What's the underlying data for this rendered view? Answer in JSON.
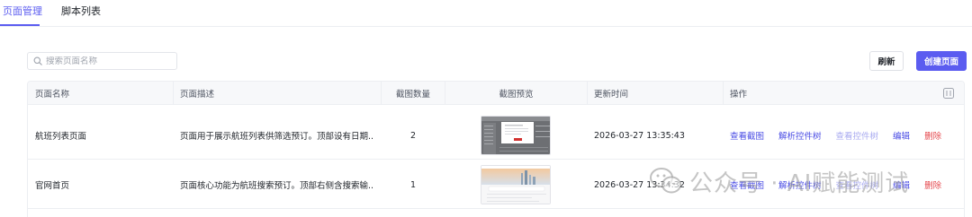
{
  "tabs": [
    {
      "label": "页面管理",
      "active": true
    },
    {
      "label": "脚本列表",
      "active": false
    }
  ],
  "toolbar": {
    "search_placeholder": "搜索页面名称",
    "refresh_label": "刷新",
    "create_label": "创建页面"
  },
  "table": {
    "headers": {
      "name": "页面名称",
      "desc": "页面描述",
      "count": "截图数量",
      "preview": "截图预览",
      "updated": "更新时间",
      "actions": "操作"
    },
    "rows": [
      {
        "name": "航班列表页面",
        "desc": "页面用于展示航班列表供筛选预订。顶部设有日期...",
        "count": "2",
        "updated": "2026-03-27 13:35:43",
        "actions": [
          {
            "label": "查看截图",
            "state": "enabled"
          },
          {
            "label": "解析控件树",
            "state": "enabled"
          },
          {
            "label": "查看控件树",
            "state": "disabled"
          },
          {
            "label": "编辑",
            "state": "enabled"
          },
          {
            "label": "删除",
            "state": "danger"
          }
        ]
      },
      {
        "name": "官网首页",
        "desc": "页面核心功能为航班搜索预订。顶部右侧含搜索输...",
        "count": "1",
        "updated": "2026-03-27 13:34:32",
        "actions": [
          {
            "label": "查看截图",
            "state": "enabled"
          },
          {
            "label": "解析控件树",
            "state": "enabled"
          },
          {
            "label": "查看控件树",
            "state": "disabled"
          },
          {
            "label": "编辑",
            "state": "enabled"
          },
          {
            "label": "删除",
            "state": "danger"
          }
        ]
      }
    ]
  },
  "watermark": {
    "text": "公众号 · AI赋能测试",
    "icon": "wechat-icon"
  },
  "colors": {
    "accent": "#5b5cf0",
    "link": "#4a4ce4",
    "link_disabled": "#a8aaf0",
    "danger": "#e5484d"
  }
}
